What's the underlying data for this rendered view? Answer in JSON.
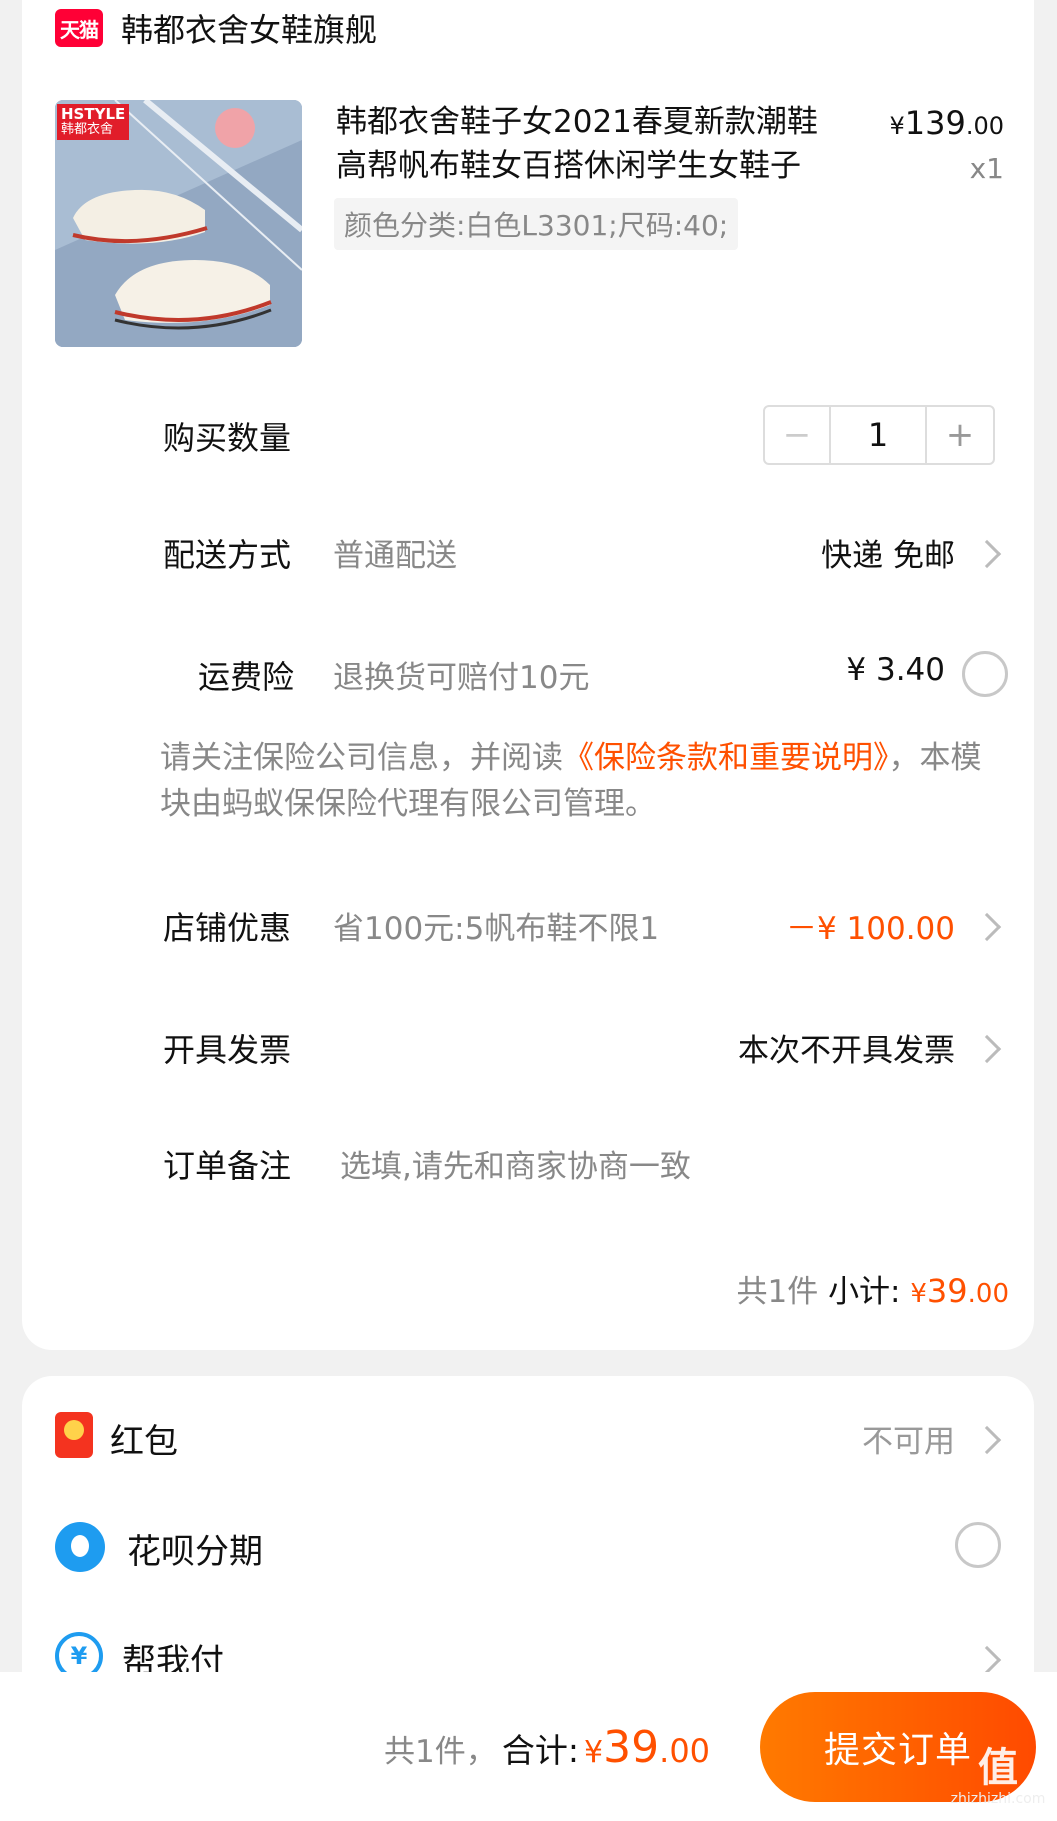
{
  "store": {
    "badge": "天猫",
    "name": "韩都衣舍女鞋旗舰"
  },
  "product": {
    "thumb_logo_line1": "HSTYLE",
    "thumb_logo_line2": "韩都衣舍",
    "title": "韩都衣舍鞋子女2021春夏新款潮鞋高帮帆布鞋女百搭休闲学生女鞋子",
    "price_currency": "¥",
    "price_int": "139",
    "price_dec": ".00",
    "quantity_text": "x1",
    "sku": "颜色分类:白色L3301;尺码:40;"
  },
  "rows": {
    "quantity_label": "购买数量",
    "quantity_value": "1",
    "minus": "−",
    "plus": "+",
    "shipping_label": "配送方式",
    "shipping_desc": "普通配送",
    "shipping_value": "快递 免邮",
    "insurance_label": "运费险",
    "insurance_desc": "退换货可赔付10元",
    "insurance_value": "¥ 3.40",
    "note_prefix": "请关注保险公司信息，并阅读",
    "note_link": "《保险条款和重要说明》",
    "note_suffix": "，本模块由蚂蚁保保险代理有限公司管理。",
    "discount_label": "店铺优惠",
    "discount_desc": "省100元:5帆布鞋不限1",
    "discount_value": "－¥ 100.00",
    "invoice_label": "开具发票",
    "invoice_value": "本次不开具发票",
    "remark_label": "订单备注",
    "remark_placeholder": "选填,请先和商家协商一致"
  },
  "subtotal": {
    "count": "共1件",
    "label": "小计:",
    "currency": "¥",
    "int": "39",
    "dec": ".00"
  },
  "payment": {
    "hongbao_label": "红包",
    "hongbao_value": "不可用",
    "huabei_label": "花呗分期",
    "bangwofu_label": "帮我付",
    "bangwofu_icon": "¥"
  },
  "bottom": {
    "count": "共1件，",
    "total_label": "合计:",
    "currency": "¥",
    "int": "39",
    "dec": ".00",
    "submit": "提交订单"
  },
  "watermark": {
    "text": "值",
    "site": "zhizhizhi.com"
  },
  "colors": {
    "accent": "#ff5000",
    "tmall": "#ff0036",
    "alipay_blue": "#1e9cf0"
  }
}
